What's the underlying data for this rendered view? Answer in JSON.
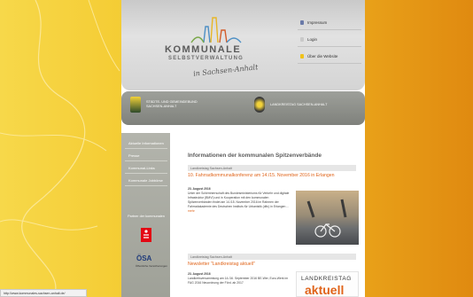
{
  "header": {
    "logo": {
      "title": "KOMMUNALE",
      "subtitle": "SELBSTVERWALTUNG",
      "script": "in Sachsen-Anhalt"
    },
    "links": [
      {
        "label": "Impressum",
        "color": "#6a7aa8"
      },
      {
        "label": "Login",
        "color": "#c9c9c9"
      },
      {
        "label": "Über die Website",
        "color": "#f0c21a"
      }
    ]
  },
  "org_bar": {
    "left_org": "STÄDTE- UND GEMEINDEBUND SACHSEN-ANHALT",
    "right_org": "LANDKREISTAG SACHSEN-ANHALT"
  },
  "sidebar": {
    "items": [
      "Aktuelle Informationen",
      "Presse",
      "Kommunal-Links",
      "Kommunale Jobbörse"
    ],
    "partner_label": "Partner der kommunalen",
    "partner_logo2": "ÖSA",
    "partner_logo2_sub": "Öffentliche Versicherungen"
  },
  "main": {
    "title": "Informationen der kommunalen Spitzenverbände",
    "news": [
      {
        "section": "Landkreistag Sachsen-Anhalt",
        "title": "10. Fahrradkommunalkonferenz am 14./15. November 2016 in Erlangen",
        "date": "23. August 2016",
        "text": "Unter der Schirmherrschaft des Bundesministeriums für Verkehr und digitale Infrastruktur (BMVI) und in Kooperation mit den kommunalen Spitzenverbänden findet am 14./15. November 2016 im Rahmen der Fahrradakademie des Deutschen Instituts für Urbanistik (difu) in Erlangen ...",
        "more": "mehr"
      },
      {
        "section": "Landkreistag Sachsen-Anhalt",
        "title": "Newsletter \"Landkreistag aktuell\"",
        "date": "23. August 2016",
        "text": "Landkreisversammlung am 14./16. September 2016 BE-Wer, Euro-Werk im FAG 2016 Neuordnung der Förd. ab 2017",
        "more": ""
      }
    ],
    "image2_text1": "LANDKREISTAG",
    "image2_text2": "aktuell"
  },
  "status_bar": {
    "url": "http://www.kommunales-sachsen-anhalt.de/"
  },
  "colors": {
    "accent": "#e0641a",
    "header_grey": "#d4d4d4",
    "yellow": "#f3c628"
  }
}
